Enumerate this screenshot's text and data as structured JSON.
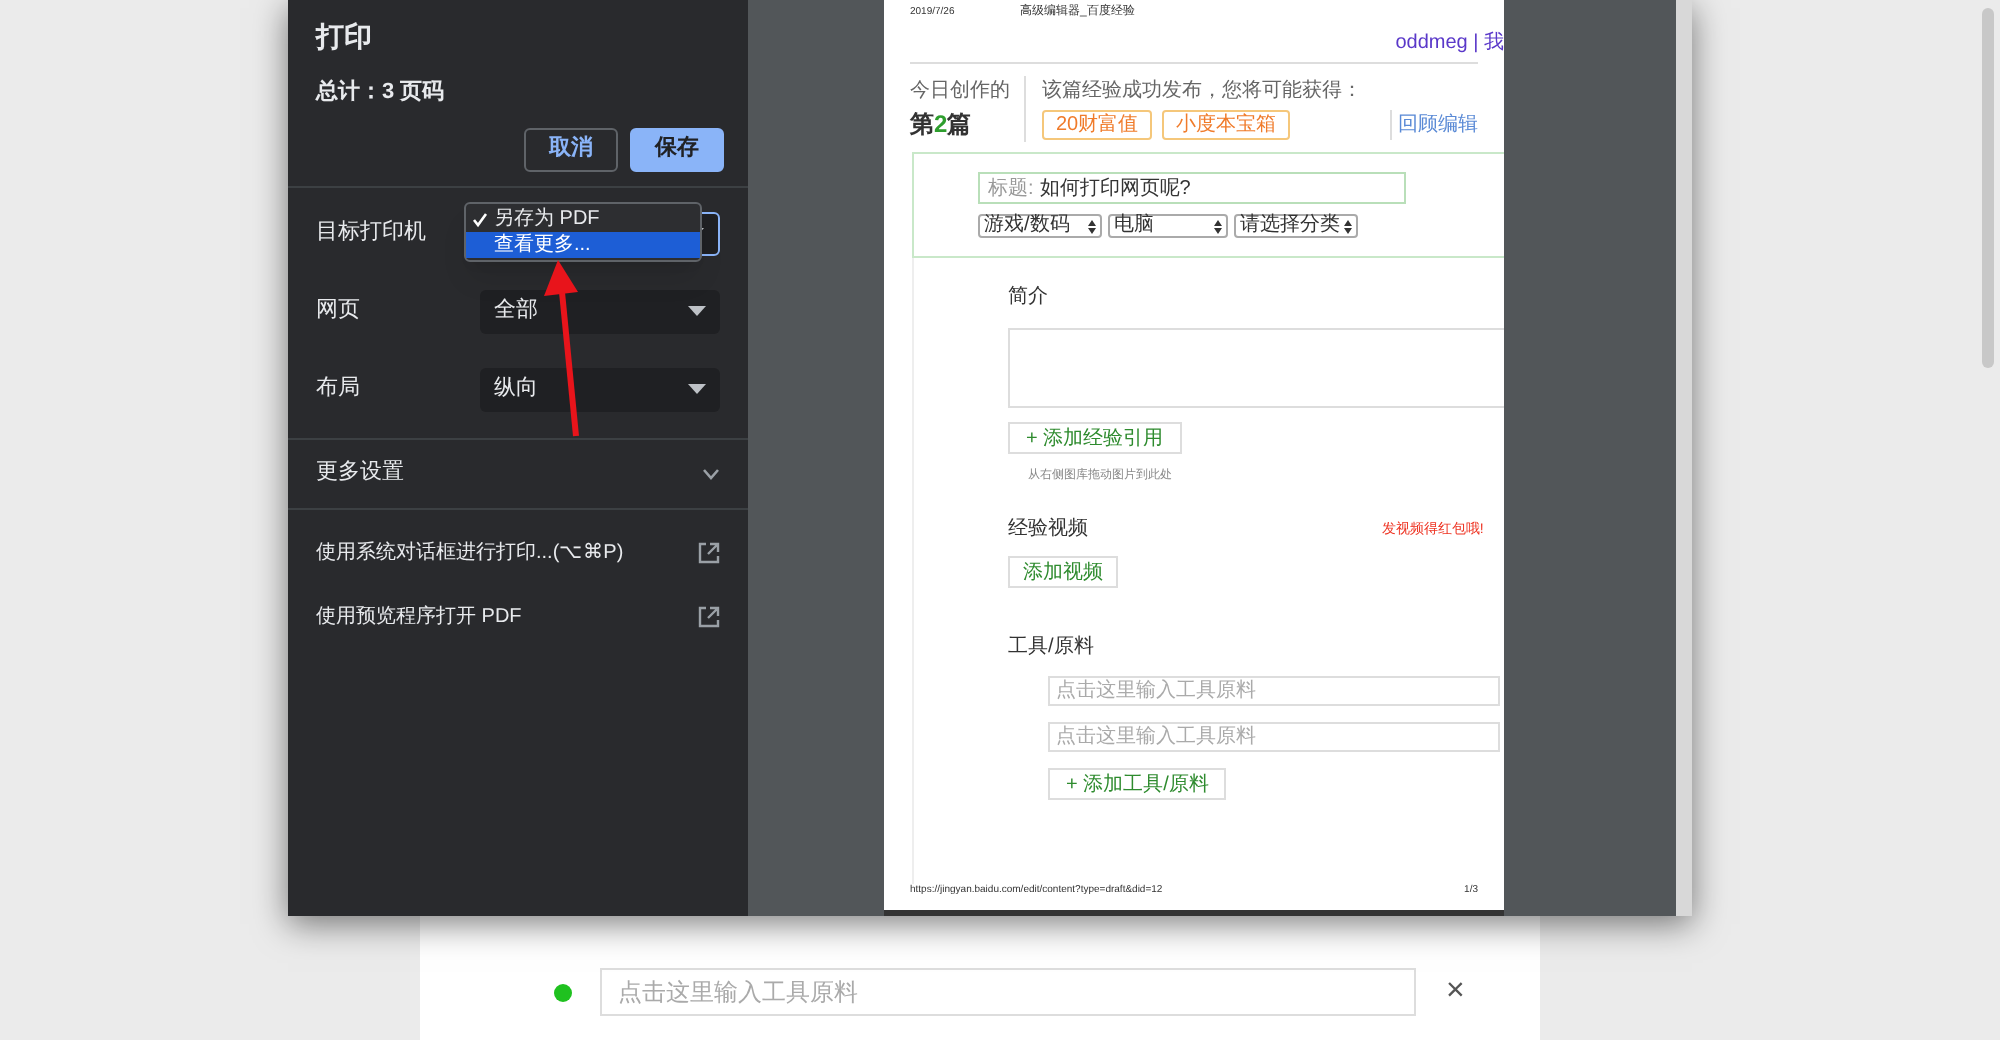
{
  "page_background": {
    "tool_field": {
      "placeholder": "点击这里输入工具原料"
    },
    "remove_label": "×"
  },
  "print_dialog": {
    "title": "打印",
    "total": "总计：3 页码",
    "buttons": [
      {
        "label": "取消",
        "kind": "secondary"
      },
      {
        "label": "保存",
        "kind": "primary"
      }
    ],
    "settings": [
      {
        "label": "目标打印机"
      },
      {
        "label": "网页",
        "value": "全部"
      },
      {
        "label": "布局",
        "value": "纵向"
      }
    ],
    "printer_menu": [
      {
        "label": "另存为 PDF",
        "checked": true,
        "highlighted": false
      },
      {
        "label": "查看更多...",
        "checked": false,
        "highlighted": true
      }
    ],
    "more_settings": {
      "label": "更多设置",
      "expanded": false
    },
    "links": [
      "使用系统对话框进行打印...(⌥⌘P)",
      "使用预览程序打开 PDF"
    ]
  },
  "preview": {
    "date": "2019/7/26",
    "doc_title": "高级编辑器_百度经验",
    "user": "oddmeg | 我",
    "today_label": "今日创作的",
    "today_count": {
      "prefix": "第",
      "number": "2",
      "suffix": "篇"
    },
    "reward_text": "该篇经验成功发布，您将可能获得：",
    "rewards": [
      "20财富值",
      "小度本宝箱"
    ],
    "editor_link": "回顾编辑",
    "title_field": {
      "label": "标题:",
      "value": "如何打印网页呢?"
    },
    "categories": [
      "游戏/数码",
      "电脑",
      "请选择分类"
    ],
    "intro_heading": "简介",
    "add_reference": "+ 添加经验引用",
    "drop_hint": "从右侧图库拖动图片到此处",
    "video_heading": "经验视频",
    "video_promo": "发视频得红包哦!",
    "add_video": "添加视频",
    "tools_heading": "工具/原料",
    "tool_fields": [
      {
        "placeholder": "点击这里输入工具原料"
      },
      {
        "placeholder": "点击这里输入工具原料"
      }
    ],
    "add_tool": "+ 添加工具/原料",
    "footer_url": "https://jingyan.baidu.com/edit/content?type=draft&did=12",
    "page_number": "1/3"
  }
}
